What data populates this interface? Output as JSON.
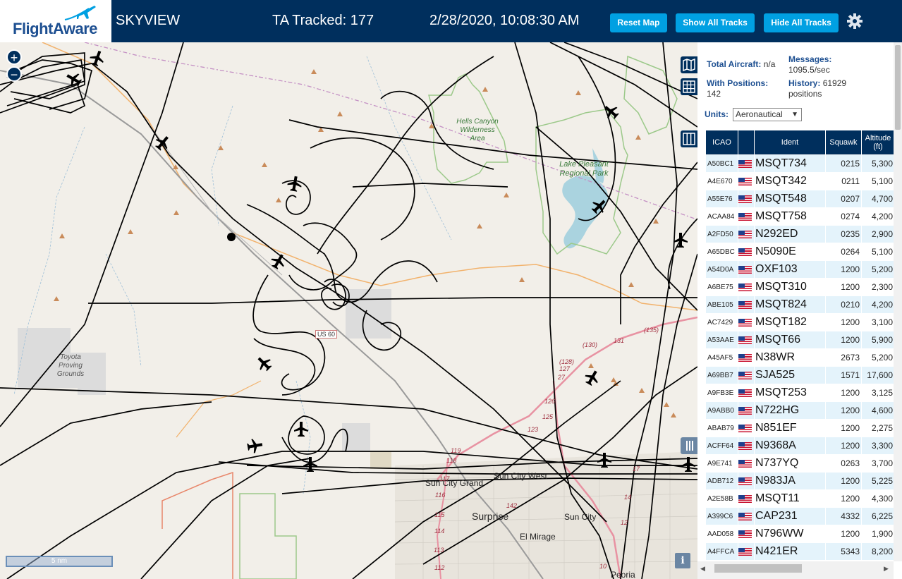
{
  "header": {
    "logo_text": "FlightAware",
    "site_name": "SKYVIEW",
    "tracked": "TA Tracked: 177",
    "clock": "2/28/2020, 10:08:30 AM",
    "buttons": {
      "reset": "Reset Map",
      "show_all": "Show All Tracks",
      "hide_all": "Hide All Tracks"
    }
  },
  "map": {
    "zoom_in": "+",
    "zoom_out": "−",
    "scale_label": "5 nm",
    "info": "i",
    "labels": {
      "hells_canyon": "Hells Canyon Wilderness Area",
      "lake_pleasant": "Lake Pleasant Regional Park",
      "toyota": "Toyota Proving Grounds",
      "us60": "US 60",
      "sun_city_grand": "Sun City Grand",
      "sun_city_west": "Sun City West",
      "surprise": "Surprise",
      "sun_city": "Sun City",
      "el_mirage": "El Mirage",
      "peoria": "Peoria",
      "r135": "(135)",
      "r130": "(130)",
      "r131": "131",
      "r128": "(128)",
      "r127": "127",
      "r27": "27",
      "r126": "126",
      "r125": "125",
      "r123": "123",
      "r119": "119",
      "r118": "118",
      "r117": "117",
      "r116": "116",
      "r115": "115",
      "r114": "114",
      "r113": "113",
      "r112": "112",
      "r142": "142",
      "r14": "14",
      "r12": "12",
      "r10": "10",
      "r17": "17"
    }
  },
  "stats": {
    "total_label": "Total Aircraft:",
    "total_value": "n/a",
    "messages_label": "Messages:",
    "messages_value": "1095.5/sec",
    "positions_label": "With Positions:",
    "positions_value": "142",
    "history_label": "History:",
    "history_value": "61929",
    "history_unit": "positions"
  },
  "units": {
    "label": "Units:",
    "value": "Aeronautical"
  },
  "table": {
    "headers": {
      "icao": "ICAO",
      "flag": "",
      "ident": "Ident",
      "squawk": "Squawk",
      "altitude": "Altitude (ft)"
    },
    "rows": [
      {
        "icao": "A50BC1",
        "ident": "MSQT734",
        "squawk": "0215",
        "altitude": "5,300"
      },
      {
        "icao": "A4E670",
        "ident": "MSQT342",
        "squawk": "0211",
        "altitude": "5,100"
      },
      {
        "icao": "A55E76",
        "ident": "MSQT548",
        "squawk": "0207",
        "altitude": "4,700"
      },
      {
        "icao": "ACAA84",
        "ident": "MSQT758",
        "squawk": "0274",
        "altitude": "4,200"
      },
      {
        "icao": "A2FD50",
        "ident": "N292ED",
        "squawk": "0235",
        "altitude": "2,900"
      },
      {
        "icao": "A65DBC",
        "ident": "N5090E",
        "squawk": "0264",
        "altitude": "5,100"
      },
      {
        "icao": "A54D0A",
        "ident": "OXF103",
        "squawk": "1200",
        "altitude": "5,200"
      },
      {
        "icao": "A6BE75",
        "ident": "MSQT310",
        "squawk": "1200",
        "altitude": "2,300"
      },
      {
        "icao": "ABE105",
        "ident": "MSQT824",
        "squawk": "0210",
        "altitude": "4,200"
      },
      {
        "icao": "AC7429",
        "ident": "MSQT182",
        "squawk": "1200",
        "altitude": "3,100"
      },
      {
        "icao": "A53AAE",
        "ident": "MSQT66",
        "squawk": "1200",
        "altitude": "5,900"
      },
      {
        "icao": "A45AF5",
        "ident": "N38WR",
        "squawk": "2673",
        "altitude": "5,200"
      },
      {
        "icao": "A69BB7",
        "ident": "SJA525",
        "squawk": "1571",
        "altitude": "17,600"
      },
      {
        "icao": "A9FB3E",
        "ident": "MSQT253",
        "squawk": "1200",
        "altitude": "3,125"
      },
      {
        "icao": "A9ABB0",
        "ident": "N722HG",
        "squawk": "1200",
        "altitude": "4,600"
      },
      {
        "icao": "ABAB79",
        "ident": "N851EF",
        "squawk": "1200",
        "altitude": "2,275"
      },
      {
        "icao": "ACFF64",
        "ident": "N9368A",
        "squawk": "1200",
        "altitude": "3,300"
      },
      {
        "icao": "A9E741",
        "ident": "N737YQ",
        "squawk": "0263",
        "altitude": "3,700"
      },
      {
        "icao": "ADB712",
        "ident": "N983JA",
        "squawk": "1200",
        "altitude": "5,225"
      },
      {
        "icao": "A2E58B",
        "ident": "MSQT11",
        "squawk": "1200",
        "altitude": "4,300"
      },
      {
        "icao": "A399C6",
        "ident": "CAP231",
        "squawk": "4332",
        "altitude": "6,225"
      },
      {
        "icao": "AAD058",
        "ident": "N796WW",
        "squawk": "1200",
        "altitude": "1,900"
      },
      {
        "icao": "A4FFCA",
        "ident": "N421ER",
        "squawk": "5343",
        "altitude": "8,200"
      }
    ]
  },
  "colors": {
    "header_bg": "#002f5d",
    "button_bg": "#00a0e2",
    "row_alt": "#e4f3fb",
    "accent": "#1d4f91"
  }
}
